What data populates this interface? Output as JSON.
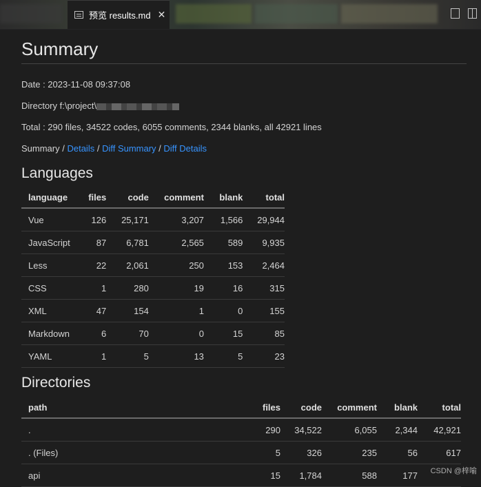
{
  "tab": {
    "title": "预览 results.md",
    "close": "✕"
  },
  "page": {
    "title": "Summary",
    "date": "Date : 2023-11-08 09:37:08",
    "directory_prefix": "Directory f:\\project\\",
    "total": "Total : 290 files, 34522 codes, 6055 comments, 2344 blanks, all 42921 lines",
    "nav": {
      "summary": "Summary",
      "sep": " / ",
      "details": "Details",
      "diff_summary": "Diff Summary",
      "diff_details": "Diff Details"
    }
  },
  "languages": {
    "heading": "Languages",
    "columns": [
      "language",
      "files",
      "code",
      "comment",
      "blank",
      "total"
    ],
    "rows": [
      [
        "Vue",
        "126",
        "25,171",
        "3,207",
        "1,566",
        "29,944"
      ],
      [
        "JavaScript",
        "87",
        "6,781",
        "2,565",
        "589",
        "9,935"
      ],
      [
        "Less",
        "22",
        "2,061",
        "250",
        "153",
        "2,464"
      ],
      [
        "CSS",
        "1",
        "280",
        "19",
        "16",
        "315"
      ],
      [
        "XML",
        "47",
        "154",
        "1",
        "0",
        "155"
      ],
      [
        "Markdown",
        "6",
        "70",
        "0",
        "15",
        "85"
      ],
      [
        "YAML",
        "1",
        "5",
        "13",
        "5",
        "23"
      ]
    ]
  },
  "directories": {
    "heading": "Directories",
    "columns": [
      "path",
      "files",
      "code",
      "comment",
      "blank",
      "total"
    ],
    "rows": [
      [
        ".",
        "290",
        "34,522",
        "6,055",
        "2,344",
        "42,921"
      ],
      [
        ". (Files)",
        "5",
        "326",
        "235",
        "56",
        "617"
      ],
      [
        "api",
        "15",
        "1,784",
        "588",
        "177",
        ""
      ]
    ]
  },
  "watermark": "CSDN @梓喻"
}
